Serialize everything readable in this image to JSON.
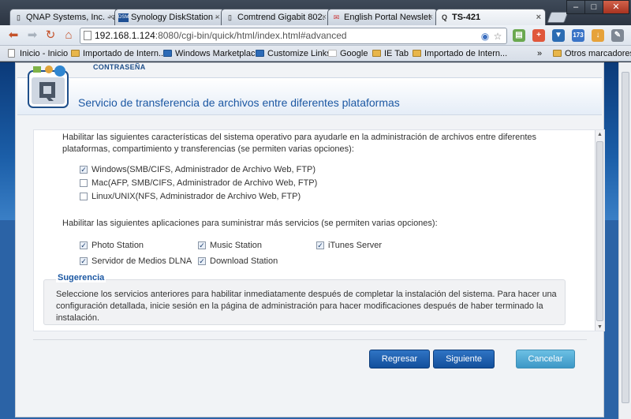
{
  "browser": {
    "tabs": [
      {
        "title": "QNAP Systems, Inc. - a",
        "icon": "page-icon"
      },
      {
        "title": "Synology DiskStation -",
        "icon": "dsm-icon",
        "badge": "DSM"
      },
      {
        "title": "Comtrend Gigabit 802.",
        "icon": "page-icon"
      },
      {
        "title": "English Portal Newslet",
        "icon": "gmail-icon"
      },
      {
        "title": "TS-421",
        "icon": "qnap-icon",
        "active": true
      }
    ],
    "close_glyph": "×",
    "window_controls": {
      "minimize": "–",
      "maximize": "□",
      "close": "✕"
    },
    "address": {
      "host": "192.168.1.124",
      "rest": ":8080/cgi-bin/quick/html/index.html#advanced"
    },
    "bookmarks": [
      {
        "label": "Inicio - Inicio",
        "icon": "page"
      },
      {
        "label": "Importado de Intern...",
        "icon": "folder"
      },
      {
        "label": "Windows Marketplace",
        "icon": "win"
      },
      {
        "label": "Customize Links",
        "icon": "win"
      },
      {
        "label": "Google",
        "icon": "google"
      },
      {
        "label": "IE Tab",
        "icon": "folder"
      },
      {
        "label": "Importado de Intern...",
        "icon": "folder"
      },
      {
        "label": "Otros marcadores",
        "icon": "folder"
      }
    ],
    "bookmarks_overflow": "»",
    "ext_badge": "173"
  },
  "wizard": {
    "top_label": "CONTRASEÑA",
    "title": "Servicio de transferencia de archivos entre diferentes plataformas",
    "os_intro": "Habilitar las siguientes características del sistema operativo para ayudarle en la administración de archivos entre diferentes plataformas, compartimiento y transferencias (se permiten varias opciones):",
    "os_options": [
      {
        "label": "Windows(SMB/CIFS, Administrador de Archivo Web, FTP)",
        "checked": true
      },
      {
        "label": "Mac(AFP, SMB/CIFS, Administrador de Archivo Web, FTP)",
        "checked": false
      },
      {
        "label": "Linux/UNIX(NFS, Administrador de Archivo Web, FTP)",
        "checked": false
      }
    ],
    "apps_intro": "Habilitar las siguientes aplicaciones para suministrar más servicios (se permiten varias opciones):",
    "apps": [
      {
        "label": "Photo Station",
        "checked": true
      },
      {
        "label": "Music Station",
        "checked": true
      },
      {
        "label": "iTunes Server",
        "checked": true
      },
      {
        "label": "Servidor de Medios DLNA",
        "checked": true
      },
      {
        "label": "Download Station",
        "checked": true
      }
    ],
    "tip_title": "Sugerencia",
    "tip_text": "Seleccione los servicios anteriores para habilitar inmediatamente después de completar la instalación del sistema. Para hacer una configuración detallada, inicie sesión en la página de administración para hacer modificaciones después de haber terminado la instalación.",
    "buttons": {
      "back": "Regresar",
      "next": "Siguiente",
      "cancel": "Cancelar"
    },
    "check_glyph": "✓"
  }
}
